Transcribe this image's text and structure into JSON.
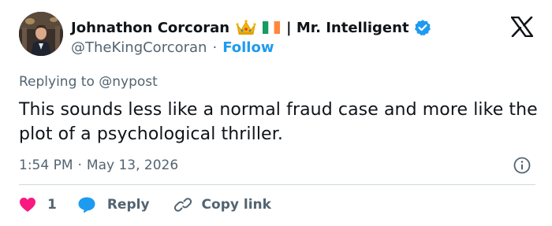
{
  "author": {
    "display_name": "Johnathon Corcoran",
    "name_suffix": "| Mr. Intelligent",
    "handle": "@TheKingCorcoran",
    "follow_label": "Follow",
    "emojis": [
      "crown",
      "ireland-flag"
    ],
    "verified": true
  },
  "tweet": {
    "replying_to": "Replying to @nypost",
    "text": "This sounds less like a normal fraud case and more like the plot of a psychological thriller.",
    "time": "1:54 PM",
    "date": "May 13, 2026"
  },
  "actions": {
    "like_count": "1",
    "reply_label": "Reply",
    "copy_link_label": "Copy link"
  },
  "colors": {
    "accent": "#1d9bf0",
    "like": "#f91880",
    "text": "#0f1419",
    "muted": "#536471",
    "divider": "#cfd9de"
  },
  "separator": "·"
}
